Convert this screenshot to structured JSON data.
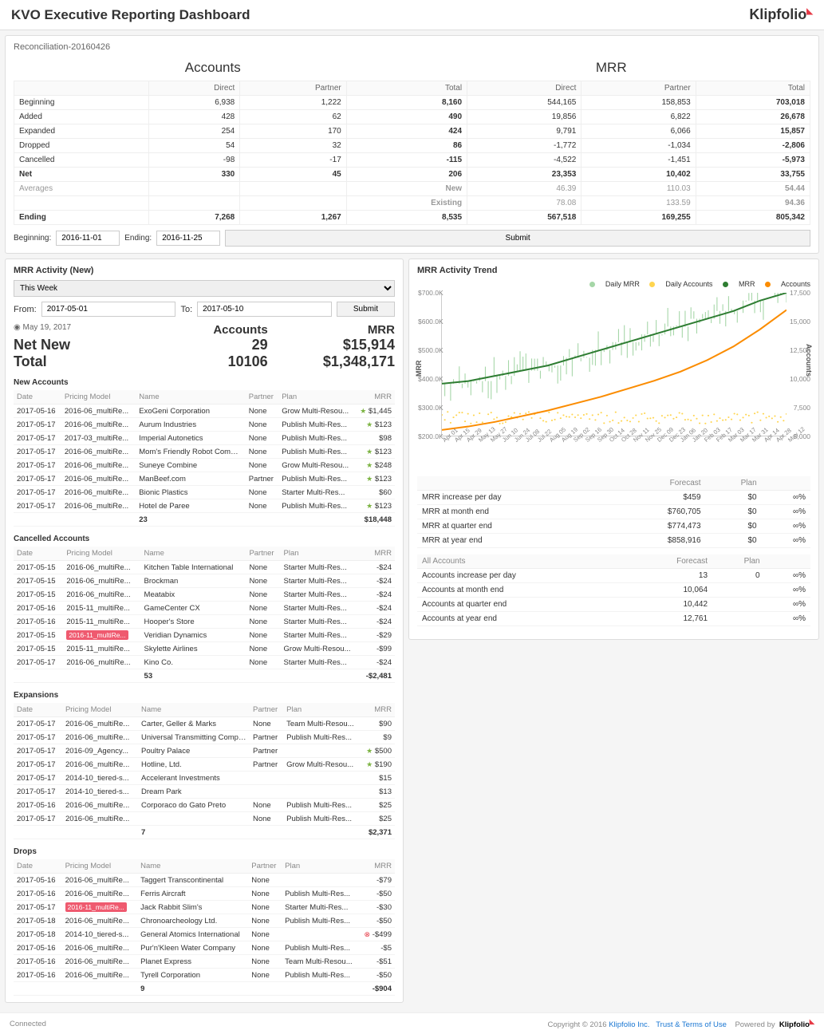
{
  "header": {
    "title": "KVO Executive Reporting Dashboard",
    "brand": "Klipfolio"
  },
  "reconciliation": {
    "title": "Reconciliation-20160426",
    "left_header": "Accounts",
    "right_header": "MRR",
    "cols": [
      "",
      "Direct",
      "Partner",
      "Total",
      "Direct",
      "Partner",
      "Total"
    ],
    "rows": [
      {
        "label": "Beginning",
        "v": [
          "6,938",
          "1,222",
          "8,160",
          "544,165",
          "158,853",
          "703,018"
        ],
        "cls": ""
      },
      {
        "label": "Added",
        "v": [
          "428",
          "62",
          "490",
          "19,856",
          "6,822",
          "26,678"
        ],
        "cls": ""
      },
      {
        "label": "Expanded",
        "v": [
          "254",
          "170",
          "424",
          "9,791",
          "6,066",
          "15,857"
        ],
        "cls": ""
      },
      {
        "label": "Dropped",
        "v": [
          "54",
          "32",
          "86",
          "-1,772",
          "-1,034",
          "-2,806"
        ],
        "cls": ""
      },
      {
        "label": "Cancelled",
        "v": [
          "-98",
          "-17",
          "-115",
          "-4,522",
          "-1,451",
          "-5,973"
        ],
        "cls": ""
      },
      {
        "label": "Net",
        "v": [
          "330",
          "45",
          "206",
          "23,353",
          "10,402",
          "33,755"
        ],
        "cls": "bold"
      },
      {
        "label": "Averages",
        "v": [
          "",
          "",
          "New",
          "46.39",
          "110.03",
          "54.44"
        ],
        "cls": "muted"
      },
      {
        "label": "",
        "v": [
          "",
          "",
          "Existing",
          "78.08",
          "133.59",
          "94.36"
        ],
        "cls": "muted"
      },
      {
        "label": "Ending",
        "v": [
          "7,268",
          "1,267",
          "8,535",
          "567,518",
          "169,255",
          "805,342"
        ],
        "cls": "bold"
      }
    ],
    "beginning_label": "Beginning:",
    "beginning_value": "2016-11-01",
    "ending_label": "Ending:",
    "ending_value": "2016-11-25",
    "submit": "Submit"
  },
  "activity": {
    "title": "MRR Activity (New)",
    "range_select": "This Week",
    "from_label": "From:",
    "from_value": "2017-05-01",
    "to_label": "To:",
    "to_value": "2017-05-10",
    "submit": "Submit",
    "asof_icon": "◉",
    "asof": "May 19, 2017",
    "col_accounts": "Accounts",
    "col_mrr": "MRR",
    "netnew_label": "Net New",
    "netnew_accounts": "29",
    "netnew_mrr": "$15,914",
    "total_label": "Total",
    "total_accounts": "10106",
    "total_mrr": "$1,348,171",
    "sections": {
      "new": {
        "title": "New Accounts",
        "headers": [
          "Date",
          "Pricing Model",
          "Name",
          "Partner",
          "Plan",
          "MRR"
        ],
        "rows": [
          [
            "2017-05-16",
            "2016-06_multiRe...",
            "ExoGeni Corporation",
            "None",
            "Grow Multi-Resou...",
            "★ $1,445"
          ],
          [
            "2017-05-17",
            "2016-06_multiRe...",
            "Aurum Industries",
            "None",
            "Publish Multi-Res...",
            "★ $123"
          ],
          [
            "2017-05-17",
            "2017-03_multiRe...",
            "Imperial Autonetics",
            "None",
            "Publish Multi-Res...",
            "$98"
          ],
          [
            "2017-05-17",
            "2016-06_multiRe...",
            "Mom's Friendly Robot Company",
            "None",
            "Publish Multi-Res...",
            "★ $123"
          ],
          [
            "2017-05-17",
            "2016-06_multiRe...",
            "Suneye Combine",
            "None",
            "Grow Multi-Resou...",
            "★ $248"
          ],
          [
            "2017-05-17",
            "2016-06_multiRe...",
            "ManBeef.com",
            "Partner",
            "Publish Multi-Res...",
            "★ $123"
          ],
          [
            "2017-05-17",
            "2016-06_multiRe...",
            "Bionic Plastics",
            "None",
            "Starter Multi-Res...",
            "$60"
          ],
          [
            "2017-05-17",
            "2016-06_multiRe...",
            "Hotel de Paree",
            "None",
            "Publish Multi-Res...",
            "★ $123"
          ]
        ],
        "total": [
          "",
          "",
          "23",
          "",
          "",
          "$18,448"
        ]
      },
      "cancelled": {
        "title": "Cancelled Accounts",
        "headers": [
          "Date",
          "Pricing Model",
          "Name",
          "Partner",
          "Plan",
          "MRR"
        ],
        "rows": [
          [
            "2017-05-15",
            "2016-06_multiRe...",
            "Kitchen Table International",
            "None",
            "Starter Multi-Res...",
            "-$24"
          ],
          [
            "2017-05-15",
            "2016-06_multiRe...",
            "Brockman",
            "None",
            "Starter Multi-Res...",
            "-$24"
          ],
          [
            "2017-05-15",
            "2016-06_multiRe...",
            "Meatabix",
            "None",
            "Starter Multi-Res...",
            "-$24"
          ],
          [
            "2017-05-16",
            "2015-11_multiRe...",
            "GameCenter CX",
            "None",
            "Starter Multi-Res...",
            "-$24"
          ],
          [
            "2017-05-16",
            "2015-11_multiRe...",
            "Hooper's Store",
            "None",
            "Starter Multi-Res...",
            "-$24"
          ],
          [
            "2017-05-15",
            "HL:2016-11_multiRe...",
            "Veridian Dynamics",
            "None",
            "Starter Multi-Res...",
            "-$29"
          ],
          [
            "2017-05-15",
            "2015-11_multiRe...",
            "Skylette Airlines",
            "None",
            "Grow Multi-Resou...",
            "-$99"
          ],
          [
            "2017-05-17",
            "2016-06_multiRe...",
            "Kino Co.",
            "None",
            "Starter Multi-Res...",
            "-$24"
          ]
        ],
        "total": [
          "",
          "",
          "53",
          "",
          "",
          "-$2,481"
        ]
      },
      "expansions": {
        "title": "Expansions",
        "headers": [
          "Date",
          "Pricing Model",
          "Name",
          "Partner",
          "Plan",
          "MRR"
        ],
        "rows": [
          [
            "2017-05-17",
            "2016-06_multiRe...",
            "Carter, Geller & Marks",
            "None",
            "Team Multi-Resou...",
            "$90"
          ],
          [
            "2017-05-17",
            "2016-06_multiRe...",
            "Universal Transmitting Company",
            "Partner",
            "Publish Multi-Res...",
            "$9"
          ],
          [
            "2017-05-17",
            "2016-09_Agency...",
            "Poultry Palace",
            "Partner",
            "",
            "★ $500"
          ],
          [
            "2017-05-17",
            "2016-06_multiRe...",
            "Hotline, Ltd.",
            "Partner",
            "Grow Multi-Resou...",
            "★ $190"
          ],
          [
            "2017-05-17",
            "2014-10_tiered-s...",
            "Accelerant Investments",
            "",
            "",
            "$15"
          ],
          [
            "2017-05-17",
            "2014-10_tiered-s...",
            "Dream Park",
            "",
            "",
            "$13"
          ],
          [
            "2017-05-16",
            "2016-06_multiRe...",
            "Corporaco do Gato Preto",
            "None",
            "Publish Multi-Res...",
            "$25"
          ],
          [
            "2017-05-17",
            "2016-06_multiRe...",
            "",
            "None",
            "Publish Multi-Res...",
            "$25"
          ]
        ],
        "total": [
          "",
          "",
          "7",
          "",
          "",
          "$2,371"
        ]
      },
      "drops": {
        "title": "Drops",
        "headers": [
          "Date",
          "Pricing Model",
          "Name",
          "Partner",
          "Plan",
          "MRR"
        ],
        "rows": [
          [
            "2017-05-16",
            "2016-06_multiRe...",
            "Taggert Transcontinental",
            "None",
            "",
            "-$79"
          ],
          [
            "2017-05-16",
            "2016-06_multiRe...",
            "Ferris Aircraft",
            "None",
            "Publish Multi-Res...",
            "-$50"
          ],
          [
            "2017-05-17",
            "HL:2016-11_multiRe...",
            "Jack Rabbit Slim's",
            "None",
            "Starter Multi-Res...",
            "-$30"
          ],
          [
            "2017-05-18",
            "2016-06_multiRe...",
            "Chronoarcheology Ltd.",
            "None",
            "Publish Multi-Res...",
            "-$50"
          ],
          [
            "2017-05-18",
            "2014-10_tiered-s...",
            "General Atomics International",
            "None",
            "",
            "⊗ -$499"
          ],
          [
            "2017-05-16",
            "2016-06_multiRe...",
            "Pur'n'Kleen Water Company",
            "None",
            "Publish Multi-Res...",
            "-$5"
          ],
          [
            "2017-05-16",
            "2016-06_multiRe...",
            "Planet Express",
            "None",
            "Team Multi-Resou...",
            "-$51"
          ],
          [
            "2017-05-16",
            "2016-06_multiRe...",
            "Tyrell Corporation",
            "None",
            "Publish Multi-Res...",
            "-$50"
          ]
        ],
        "total": [
          "",
          "",
          "9",
          "",
          "",
          "-$904"
        ]
      }
    }
  },
  "trend": {
    "title": "MRR Activity Trend",
    "legend": {
      "daily_mrr": "Daily MRR",
      "daily_accounts": "Daily Accounts",
      "mrr": "MRR",
      "accounts": "Accounts"
    },
    "y_left_title": "MRR",
    "y_right_title": "Accounts",
    "y_left_ticks": [
      "$700.0K",
      "$600.0K",
      "$500.0K",
      "$400.0K",
      "$300.0K",
      "$200.0K"
    ],
    "y_right_ticks": [
      "17,500",
      "15,000",
      "12,500",
      "10,000",
      "7,500",
      "5,000"
    ],
    "x_ticks": [
      "Apr 01",
      "Apr 08",
      "Apr 15",
      "Apr 22",
      "Apr 29",
      "May 06",
      "May 13",
      "May 20",
      "May 27",
      "Jun 03",
      "Jun 10",
      "Jun 17",
      "Jun 24",
      "Jul 01",
      "Jul 08",
      "Jul 15",
      "Jul 22",
      "Jul 29",
      "Aug 05",
      "Aug 12",
      "Aug 19",
      "Aug 26",
      "Sep 02",
      "Sep 09",
      "Sep 16",
      "Sep 23",
      "Sep 30",
      "Oct 07",
      "Oct 14",
      "Oct 21",
      "Oct 28",
      "Nov 04",
      "Nov 11",
      "Nov 18",
      "Nov 25",
      "Dec 02",
      "Dec 09",
      "Dec 16",
      "Dec 23",
      "Dec 30",
      "Jan 06",
      "Jan 13",
      "Jan 20",
      "Jan 27",
      "Feb 03",
      "Feb 10",
      "Feb 17",
      "Feb 24",
      "Mar 03",
      "Mar 10",
      "Mar 17",
      "Mar 24",
      "Mar 31",
      "Apr 07",
      "Apr 14",
      "Apr 21",
      "Apr 28",
      "May 05",
      "May 12"
    ],
    "forecast_mrr": {
      "headers": [
        "",
        "Forecast",
        "Plan",
        ""
      ],
      "rows": [
        [
          "MRR increase per day",
          "$459",
          "$0",
          "∞%"
        ],
        [
          "MRR at month end",
          "$760,705",
          "$0",
          "∞%"
        ],
        [
          "MRR at quarter end",
          "$774,473",
          "$0",
          "∞%"
        ],
        [
          "MRR at year end",
          "$858,916",
          "$0",
          "∞%"
        ]
      ]
    },
    "forecast_acc": {
      "headers": [
        "All Accounts",
        "Forecast",
        "Plan",
        ""
      ],
      "rows": [
        [
          "Accounts increase per day",
          "13",
          "0",
          "∞%"
        ],
        [
          "Accounts at month end",
          "10,064",
          "",
          "∞%"
        ],
        [
          "Accounts at quarter end",
          "10,442",
          "",
          "∞%"
        ],
        [
          "Accounts at year end",
          "12,761",
          "",
          "∞%"
        ]
      ]
    }
  },
  "footer": {
    "connected": "Connected",
    "copyright": "Copyright © 2016",
    "link1": "Klipfolio Inc.",
    "link2": "Trust & Terms of Use",
    "powered": "Powered by",
    "brand": "Klipfolio"
  },
  "chart_data": {
    "type": "line",
    "title": "MRR Activity Trend",
    "y_left": {
      "label": "MRR",
      "range": [
        200000,
        750000
      ]
    },
    "y_right": {
      "label": "Accounts",
      "range": [
        5000,
        17500
      ]
    },
    "x": [
      "2016-04-01",
      "2016-05-01",
      "2016-06-01",
      "2016-07-01",
      "2016-08-01",
      "2016-09-01",
      "2016-10-01",
      "2016-11-01",
      "2016-12-01",
      "2017-01-01",
      "2017-02-01",
      "2017-03-01",
      "2017-04-01",
      "2017-05-12"
    ],
    "series": [
      {
        "name": "MRR",
        "axis": "left",
        "color": "#2e7d32",
        "values": [
          400000,
          410000,
          430000,
          450000,
          470000,
          500000,
          530000,
          560000,
          590000,
          620000,
          650000,
          680000,
          720000,
          750000
        ]
      },
      {
        "name": "Accounts",
        "axis": "right",
        "color": "#fb8c00",
        "values": [
          5500,
          5800,
          6200,
          6700,
          7200,
          7800,
          8400,
          9100,
          9800,
          10600,
          11600,
          12800,
          14300,
          16000
        ]
      },
      {
        "name": "Daily MRR",
        "axis": "left",
        "color": "#a5d6a7",
        "values_note": "noisy daily spikes around MRR line, range ~300K-700K"
      },
      {
        "name": "Daily Accounts",
        "axis": "right",
        "color": "#ffd54f",
        "values_note": "noisy daily around 5500-7500"
      }
    ]
  }
}
